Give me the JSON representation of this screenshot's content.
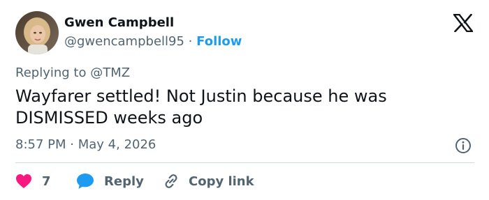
{
  "author": {
    "name": "Gwen Campbell",
    "handle": "@gwencampbell95",
    "separator": "·",
    "follow_label": "Follow"
  },
  "reply_context": {
    "prefix": "Replying to",
    "target": "@TMZ"
  },
  "tweet": {
    "text": "Wayfarer settled! Not Justin because he was\nDISMISSED weeks ago",
    "time": "8:57 PM",
    "date_separator": "·",
    "date": "May 4, 2026"
  },
  "actions": {
    "like_count": "7",
    "reply_label": "Reply",
    "copy_link_label": "Copy link"
  },
  "icons": {
    "brand": "x-logo-icon",
    "info": "info-icon",
    "like": "heart-icon",
    "reply": "speech-bubble-icon",
    "copy": "link-icon"
  },
  "colors": {
    "accent": "#1d9bf0",
    "like": "#f91880",
    "text": "#0f1419",
    "muted": "#536471",
    "divider": "#cfd9de"
  }
}
